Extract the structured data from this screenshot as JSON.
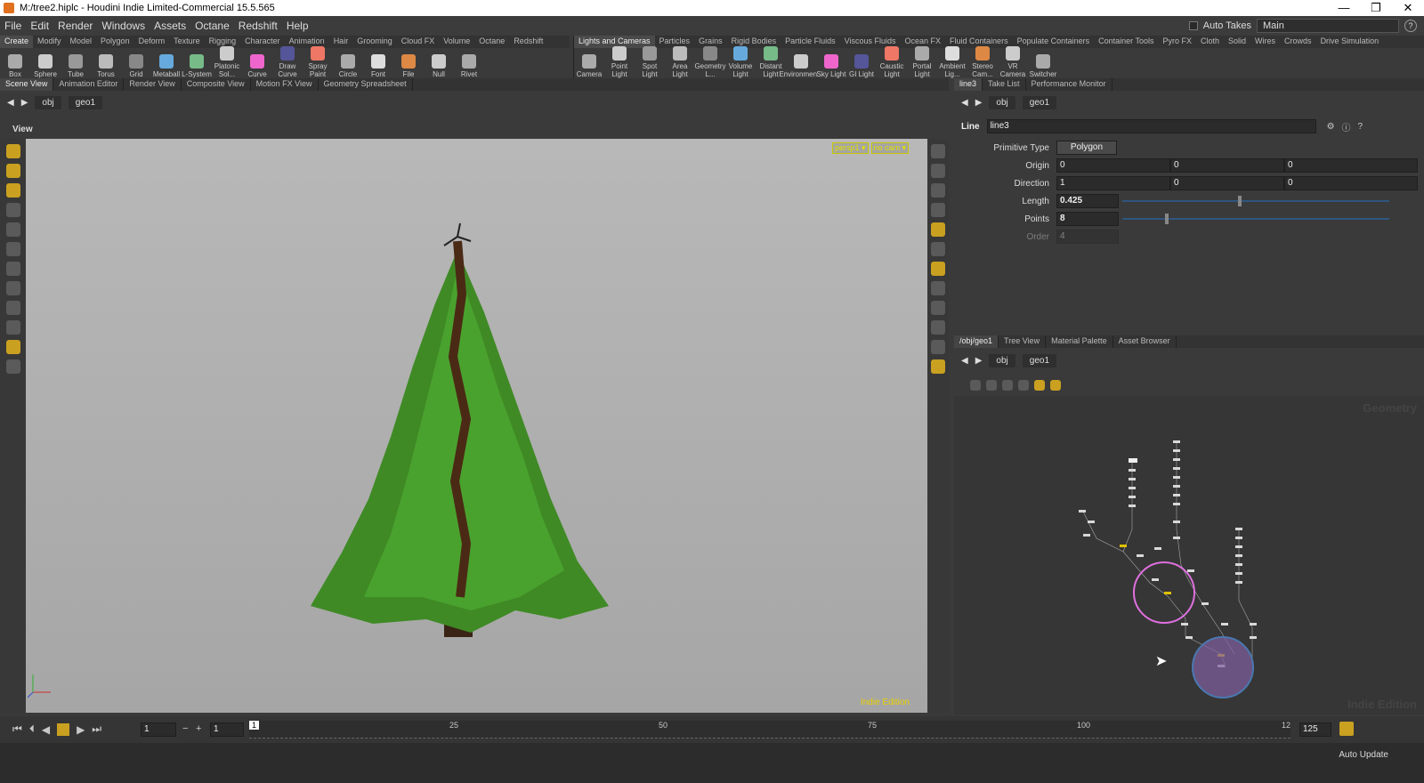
{
  "window": {
    "title": "M:/tree2.hiplc - Houdini Indie Limited-Commercial 15.5.565"
  },
  "menu": [
    "File",
    "Edit",
    "Render",
    "Windows",
    "Assets",
    "Octane",
    "Redshift",
    "Help"
  ],
  "desktop": {
    "auto_takes": "Auto Takes",
    "name": "Main"
  },
  "shelf_left": {
    "tabs": [
      "Create",
      "Modify",
      "Model",
      "Polygon",
      "Deform",
      "Texture",
      "Rigging",
      "Character",
      "Animation",
      "Hair",
      "Grooming",
      "Cloud FX",
      "Volume",
      "Octane",
      "Redshift"
    ],
    "tools": [
      "Box",
      "Sphere",
      "Tube",
      "Torus",
      "Grid",
      "Metaball",
      "L-System",
      "Platonic Sol...",
      "Curve",
      "Draw Curve",
      "Spray Paint",
      "Circle",
      "Font",
      "File",
      "Null",
      "Rivet"
    ]
  },
  "shelf_right": {
    "tabs": [
      "Lights and Cameras",
      "Particles",
      "Grains",
      "Rigid Bodies",
      "Particle Fluids",
      "Viscous Fluids",
      "Ocean FX",
      "Fluid Containers",
      "Populate Containers",
      "Container Tools",
      "Pyro FX",
      "Cloth",
      "Solid",
      "Wires",
      "Crowds",
      "Drive Simulation"
    ],
    "tools": [
      "Camera",
      "Point Light",
      "Spot Light",
      "Area Light",
      "Geometry L...",
      "Volume Light",
      "Distant Light",
      "Environmen...",
      "Sky Light",
      "GI Light",
      "Caustic Light",
      "Portal Light",
      "Ambient Lig...",
      "Stereo Cam...",
      "VR Camera",
      "Switcher"
    ]
  },
  "viewer_tabs": [
    "Scene View",
    "Animation Editor",
    "Render View",
    "Composite View",
    "Motion FX View",
    "Geometry Spreadsheet"
  ],
  "viewer_path": {
    "root": "obj",
    "node": "geo1"
  },
  "view_label": "View",
  "cam": {
    "persp": "persp1 ▾",
    "nocam": "no cam ▾"
  },
  "indie_edition": "Indie Edition",
  "param_tabs": [
    "line3",
    "Take List",
    "Performance Monitor"
  ],
  "param_path": {
    "root": "obj",
    "node": "geo1"
  },
  "node_header": {
    "type": "Line",
    "name": "line3"
  },
  "params": {
    "primitive_type": {
      "label": "Primitive Type",
      "value": "Polygon"
    },
    "origin": {
      "label": "Origin",
      "x": "0",
      "y": "0",
      "z": "0"
    },
    "direction": {
      "label": "Direction",
      "x": "1",
      "y": "0",
      "z": "0"
    },
    "length": {
      "label": "Length",
      "value": "0.425"
    },
    "points": {
      "label": "Points",
      "value": "8"
    },
    "order": {
      "label": "Order",
      "value": "4"
    }
  },
  "net_tabs": [
    "/obj/geo1",
    "Tree View",
    "Material Palette",
    "Asset Browser"
  ],
  "net_path": {
    "root": "obj",
    "node": "geo1"
  },
  "net_watermark": {
    "top": "Geometry",
    "bottom": "Indie Edition"
  },
  "timeline": {
    "current": "1",
    "start": "1",
    "end": "125",
    "ticks": [
      "1",
      "25",
      "50",
      "75",
      "100",
      "12"
    ]
  },
  "status": {
    "auto_update": "Auto Update"
  }
}
